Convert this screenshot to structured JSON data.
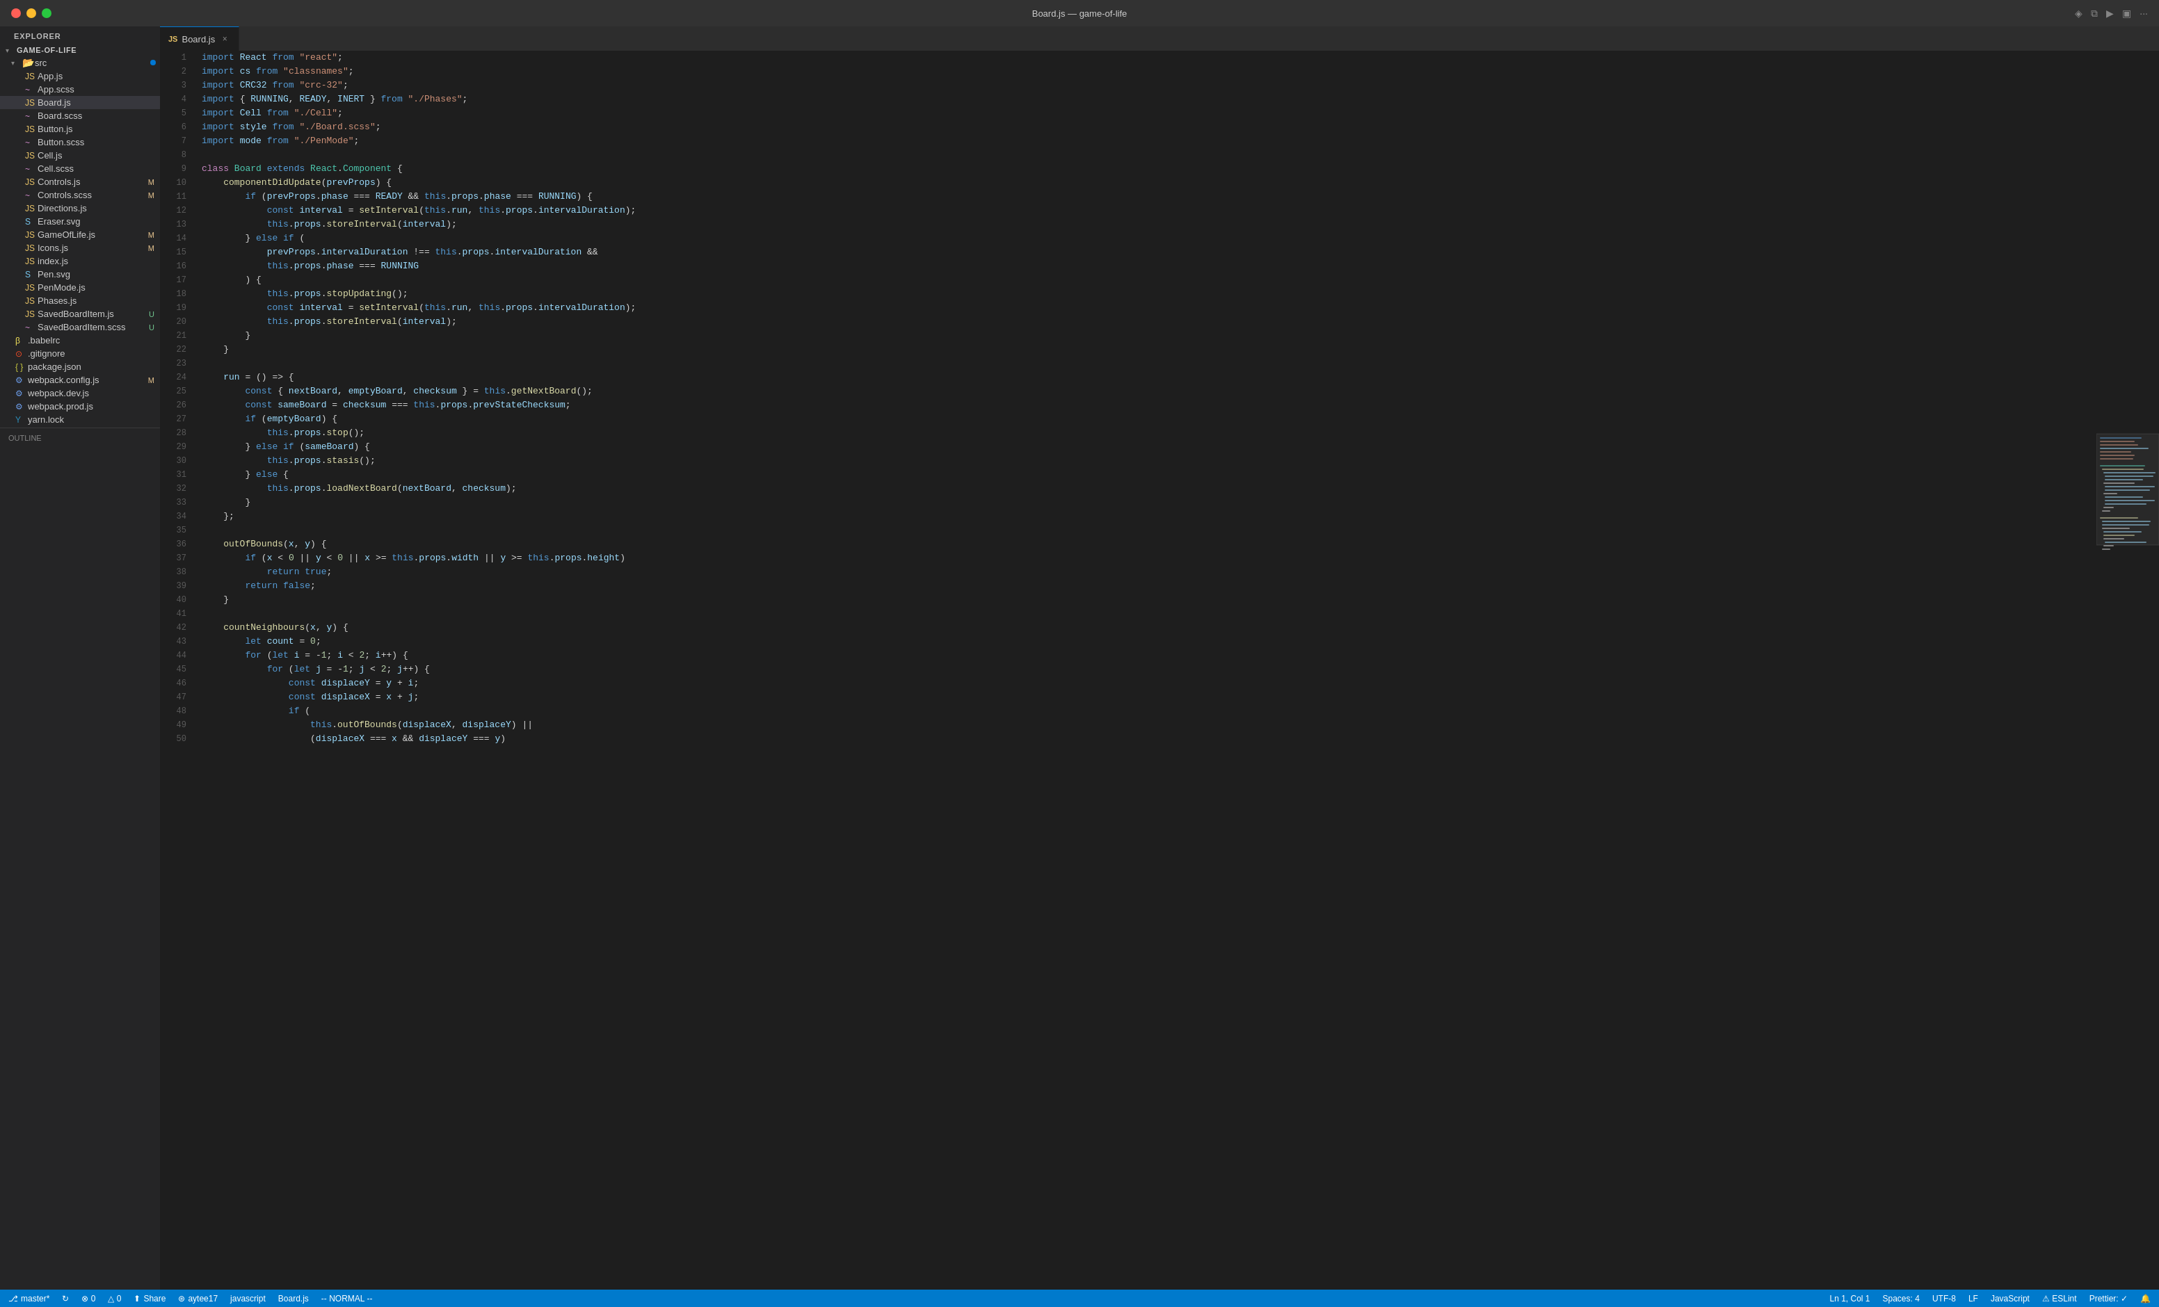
{
  "titlebar": {
    "title": "Board.js — game-of-life",
    "buttons": {
      "close": "close",
      "minimize": "minimize",
      "maximize": "maximize"
    }
  },
  "sidebar": {
    "header": "Explorer",
    "project": {
      "name": "GAME-OF-LIFE",
      "src_folder": "src",
      "files": [
        {
          "name": "App.js",
          "type": "js",
          "badge": ""
        },
        {
          "name": "App.scss",
          "type": "scss",
          "badge": ""
        },
        {
          "name": "Board.js",
          "type": "js",
          "badge": "",
          "active": true
        },
        {
          "name": "Board.scss",
          "type": "scss",
          "badge": ""
        },
        {
          "name": "Button.js",
          "type": "js",
          "badge": ""
        },
        {
          "name": "Button.scss",
          "type": "scss",
          "badge": ""
        },
        {
          "name": "Cell.js",
          "type": "js",
          "badge": ""
        },
        {
          "name": "Cell.scss",
          "type": "scss",
          "badge": ""
        },
        {
          "name": "Controls.js",
          "type": "js",
          "badge": "M"
        },
        {
          "name": "Controls.scss",
          "type": "scss",
          "badge": "M"
        },
        {
          "name": "Directions.js",
          "type": "js",
          "badge": ""
        },
        {
          "name": "Eraser.svg",
          "type": "svg",
          "badge": ""
        },
        {
          "name": "GameOfLife.js",
          "type": "js",
          "badge": "M"
        },
        {
          "name": "Icons.js",
          "type": "js",
          "badge": "M"
        },
        {
          "name": "index.js",
          "type": "js",
          "badge": ""
        },
        {
          "name": "Pen.svg",
          "type": "svg",
          "badge": ""
        },
        {
          "name": "PenMode.js",
          "type": "js",
          "badge": ""
        },
        {
          "name": "Phases.js",
          "type": "js",
          "badge": ""
        },
        {
          "name": "SavedBoardItem.js",
          "type": "js",
          "badge": "U"
        },
        {
          "name": "SavedBoardItem.scss",
          "type": "scss",
          "badge": "U"
        }
      ],
      "root_files": [
        {
          "name": ".babelrc",
          "type": "babel",
          "badge": ""
        },
        {
          "name": ".gitignore",
          "type": "git",
          "badge": ""
        },
        {
          "name": "package.json",
          "type": "json",
          "badge": ""
        },
        {
          "name": "webpack.config.js",
          "type": "config",
          "badge": "M"
        },
        {
          "name": "webpack.dev.js",
          "type": "config",
          "badge": ""
        },
        {
          "name": "webpack.prod.js",
          "type": "config",
          "badge": ""
        },
        {
          "name": "yarn.lock",
          "type": "yarn",
          "badge": ""
        }
      ]
    },
    "outline": "OUTLINE"
  },
  "tab": {
    "filename": "Board.js",
    "icon": "js"
  },
  "code": {
    "lines": [
      {
        "num": 1,
        "content": "import React from \"react\";"
      },
      {
        "num": 2,
        "content": "import cs from \"classnames\";"
      },
      {
        "num": 3,
        "content": "import CRC32 from \"crc-32\";"
      },
      {
        "num": 4,
        "content": "import { RUNNING, READY, INERT } from \"./Phases\";"
      },
      {
        "num": 5,
        "content": "import Cell from \"./Cell\";"
      },
      {
        "num": 6,
        "content": "import style from \"./Board.scss\";"
      },
      {
        "num": 7,
        "content": "import mode from \"./PenMode\";"
      },
      {
        "num": 8,
        "content": ""
      },
      {
        "num": 9,
        "content": "class Board extends React.Component {"
      },
      {
        "num": 10,
        "content": "    componentDidUpdate(prevProps) {"
      },
      {
        "num": 11,
        "content": "        if (prevProps.phase === READY && this.props.phase === RUNNING) {"
      },
      {
        "num": 12,
        "content": "            const interval = setInterval(this.run, this.props.intervalDuration);"
      },
      {
        "num": 13,
        "content": "            this.props.storeInterval(interval);"
      },
      {
        "num": 14,
        "content": "        } else if ("
      },
      {
        "num": 15,
        "content": "            prevProps.intervalDuration !== this.props.intervalDuration &&"
      },
      {
        "num": 16,
        "content": "            this.props.phase === RUNNING"
      },
      {
        "num": 17,
        "content": "        ) {"
      },
      {
        "num": 18,
        "content": "            this.props.stopUpdating();"
      },
      {
        "num": 19,
        "content": "            const interval = setInterval(this.run, this.props.intervalDuration);"
      },
      {
        "num": 20,
        "content": "            this.props.storeInterval(interval);"
      },
      {
        "num": 21,
        "content": "        }"
      },
      {
        "num": 22,
        "content": "    }"
      },
      {
        "num": 23,
        "content": ""
      },
      {
        "num": 24,
        "content": "    run = () => {"
      },
      {
        "num": 25,
        "content": "        const { nextBoard, emptyBoard, checksum } = this.getNextBoard();"
      },
      {
        "num": 26,
        "content": "        const sameBoard = checksum === this.props.prevStateChecksum;"
      },
      {
        "num": 27,
        "content": "        if (emptyBoard) {"
      },
      {
        "num": 28,
        "content": "            this.props.stop();"
      },
      {
        "num": 29,
        "content": "        } else if (sameBoard) {"
      },
      {
        "num": 30,
        "content": "            this.props.stasis();"
      },
      {
        "num": 31,
        "content": "        } else {"
      },
      {
        "num": 32,
        "content": "            this.props.loadNextBoard(nextBoard, checksum);"
      },
      {
        "num": 33,
        "content": "        }"
      },
      {
        "num": 34,
        "content": "    };"
      },
      {
        "num": 35,
        "content": ""
      },
      {
        "num": 36,
        "content": "    outOfBounds(x, y) {"
      },
      {
        "num": 37,
        "content": "        if (x < 0 || y < 0 || x >= this.props.width || y >= this.props.height)"
      },
      {
        "num": 38,
        "content": "            return true;"
      },
      {
        "num": 39,
        "content": "        return false;"
      },
      {
        "num": 40,
        "content": "    }"
      },
      {
        "num": 41,
        "content": ""
      },
      {
        "num": 42,
        "content": "    countNeighbours(x, y) {"
      },
      {
        "num": 43,
        "content": "        let count = 0;"
      },
      {
        "num": 44,
        "content": "        for (let i = -1; i < 2; i++) {"
      },
      {
        "num": 45,
        "content": "            for (let j = -1; j < 2; j++) {"
      },
      {
        "num": 46,
        "content": "                const displaceY = y + i;"
      },
      {
        "num": 47,
        "content": "                const displaceX = x + j;"
      },
      {
        "num": 48,
        "content": "                if ("
      },
      {
        "num": 49,
        "content": "                    this.outOfBounds(displaceX, displaceY) ||"
      },
      {
        "num": 50,
        "content": "                    (displaceX === x && displaceY === y)"
      }
    ]
  },
  "statusbar": {
    "branch": "master*",
    "sync": "↻",
    "errors": "⊗ 0",
    "warnings": "△ 0",
    "share": "Share",
    "github": "aytee17",
    "language_mode": "javascript",
    "breadcrumb": "Board.js",
    "vim_mode": "-- NORMAL --",
    "cursor": "Ln 1, Col 1",
    "spaces": "Spaces: 4",
    "encoding": "UTF-8",
    "line_ending": "LF",
    "language": "JavaScript",
    "eslint": "⚠ ESLint",
    "prettier": "Prettier: ✓",
    "bell": "🔔"
  }
}
